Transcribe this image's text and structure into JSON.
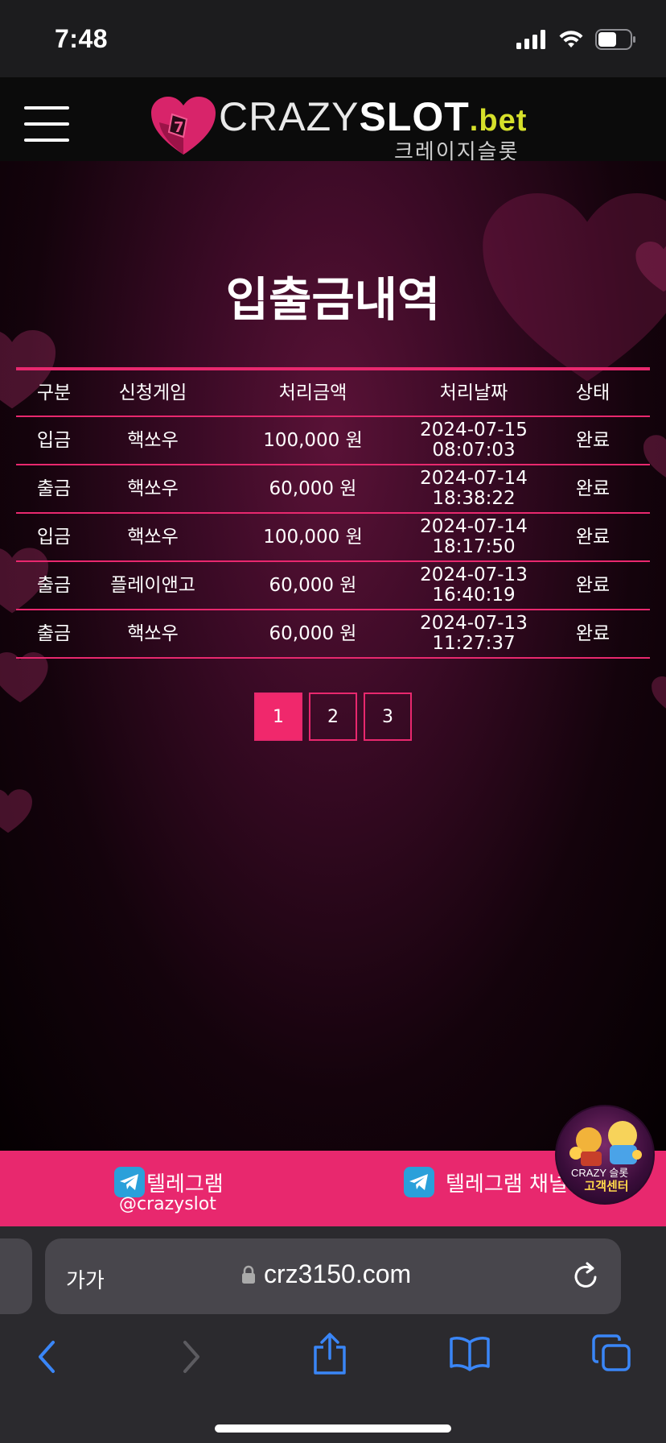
{
  "status_bar": {
    "time": "7:48"
  },
  "header": {
    "logo": {
      "part1": "CRAZY",
      "part2": "SLOT",
      "part3": ".bet",
      "subtitle": "크레이지슬롯"
    }
  },
  "page": {
    "title": "입출금내역"
  },
  "table": {
    "headers": [
      "구분",
      "신청게임",
      "처리금액",
      "처리날짜",
      "상태"
    ],
    "rows": [
      {
        "type": "입금",
        "game": "핵쏘우",
        "amount": "100,000 원",
        "date": "2024-07-15",
        "time": "08:07:03",
        "status": "완료"
      },
      {
        "type": "출금",
        "game": "핵쏘우",
        "amount": "60,000 원",
        "date": "2024-07-14",
        "time": "18:38:22",
        "status": "완료"
      },
      {
        "type": "입금",
        "game": "핵쏘우",
        "amount": "100,000 원",
        "date": "2024-07-14",
        "time": "18:17:50",
        "status": "완료"
      },
      {
        "type": "출금",
        "game": "플레이앤고",
        "amount": "60,000 원",
        "date": "2024-07-13",
        "time": "16:40:19",
        "status": "완료"
      },
      {
        "type": "출금",
        "game": "핵쏘우",
        "amount": "60,000 원",
        "date": "2024-07-13",
        "time": "11:27:37",
        "status": "완료"
      }
    ]
  },
  "pagination": {
    "pages": [
      "1",
      "2",
      "3"
    ],
    "active": "1"
  },
  "telegram": {
    "item1_label": "텔레그램",
    "item1_handle": "@crazyslot",
    "item2_label": "텔레그램 채널입"
  },
  "customer_service": {
    "brand": "CRAZY 슬롯",
    "label": "고객센터"
  },
  "browser": {
    "text_size_label": "가가",
    "url": "crz3150.com"
  },
  "colors": {
    "accent": "#e8286e",
    "active_page": "#f0286c",
    "logo_bet": "#d6e02a",
    "browser_icon": "#3a86f7"
  }
}
